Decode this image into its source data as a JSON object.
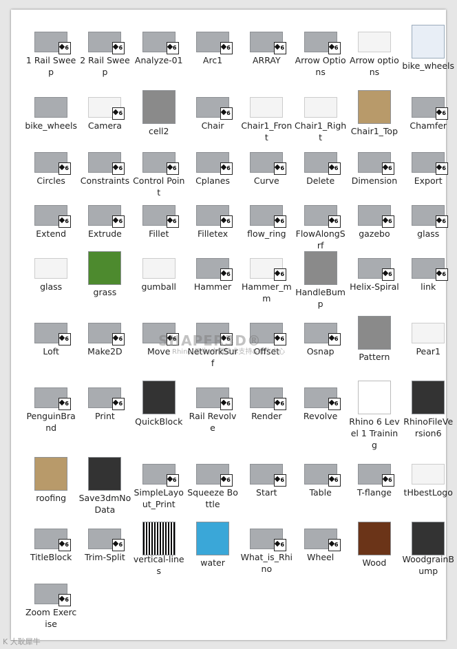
{
  "files": [
    {
      "label": "1 Rail Sweep",
      "kind": "gray",
      "badge": "6"
    },
    {
      "label": "2 Rail Sweep",
      "kind": "gray",
      "badge": "6"
    },
    {
      "label": "Analyze-01",
      "kind": "gray",
      "badge": "6"
    },
    {
      "label": "Arc1",
      "kind": "gray",
      "badge": "6"
    },
    {
      "label": "ARRAY",
      "kind": "gray",
      "badge": "6"
    },
    {
      "label": "Arrow Options",
      "kind": "gray",
      "badge": "6"
    },
    {
      "label": "Arrow options",
      "kind": "white",
      "badge": ""
    },
    {
      "label": "bike_wheels",
      "kind": "doc",
      "badge": ""
    },
    {
      "label": "bike_wheels",
      "kind": "gray",
      "badge": ""
    },
    {
      "label": "Camera",
      "kind": "white",
      "badge": "6"
    },
    {
      "label": "cell2",
      "kind": "texture",
      "badge": ""
    },
    {
      "label": "Chair",
      "kind": "gray",
      "badge": "6"
    },
    {
      "label": "Chair1_Front",
      "kind": "white",
      "badge": ""
    },
    {
      "label": "Chair1_Right",
      "kind": "white",
      "badge": ""
    },
    {
      "label": "Chair1_Top",
      "kind": "tan",
      "badge": ""
    },
    {
      "label": "Chamfer",
      "kind": "gray",
      "badge": "6"
    },
    {
      "label": "Circles",
      "kind": "gray",
      "badge": "6"
    },
    {
      "label": "Constraints",
      "kind": "gray",
      "badge": "6"
    },
    {
      "label": "Control Point",
      "kind": "gray",
      "badge": "6"
    },
    {
      "label": "Cplanes",
      "kind": "gray",
      "badge": "6"
    },
    {
      "label": "Curve",
      "kind": "gray",
      "badge": "6"
    },
    {
      "label": "Delete",
      "kind": "gray",
      "badge": "6"
    },
    {
      "label": "Dimension",
      "kind": "gray",
      "badge": "6"
    },
    {
      "label": "Export",
      "kind": "gray",
      "badge": "6"
    },
    {
      "label": "Extend",
      "kind": "gray",
      "badge": "6"
    },
    {
      "label": "Extrude",
      "kind": "gray",
      "badge": "6"
    },
    {
      "label": "Fillet",
      "kind": "gray",
      "badge": "6"
    },
    {
      "label": "Filletex",
      "kind": "gray",
      "badge": "6"
    },
    {
      "label": "flow_ring",
      "kind": "gray",
      "badge": "6"
    },
    {
      "label": "FlowAlongSrf",
      "kind": "gray",
      "badge": "6"
    },
    {
      "label": "gazebo",
      "kind": "gray",
      "badge": "6"
    },
    {
      "label": "glass",
      "kind": "gray",
      "badge": "6"
    },
    {
      "label": "glass",
      "kind": "white",
      "badge": ""
    },
    {
      "label": "grass",
      "kind": "grass",
      "badge": ""
    },
    {
      "label": "gumball",
      "kind": "white",
      "badge": ""
    },
    {
      "label": "Hammer",
      "kind": "gray",
      "badge": "6"
    },
    {
      "label": "Hammer_mm",
      "kind": "white",
      "badge": "6"
    },
    {
      "label": "HandleBump",
      "kind": "texture",
      "badge": ""
    },
    {
      "label": "Helix-Spiral",
      "kind": "gray",
      "badge": "6"
    },
    {
      "label": "link",
      "kind": "gray",
      "badge": "6"
    },
    {
      "label": "Loft",
      "kind": "gray",
      "badge": "6"
    },
    {
      "label": "Make2D",
      "kind": "gray",
      "badge": "6"
    },
    {
      "label": "Move",
      "kind": "gray",
      "badge": "6"
    },
    {
      "label": "NetworkSurf",
      "kind": "gray",
      "badge": "6"
    },
    {
      "label": "Offset",
      "kind": "gray",
      "badge": "6"
    },
    {
      "label": "Osnap",
      "kind": "gray",
      "badge": "6"
    },
    {
      "label": "Pattern",
      "kind": "texture",
      "badge": ""
    },
    {
      "label": "Pear1",
      "kind": "white",
      "badge": ""
    },
    {
      "label": "PenguinBrand",
      "kind": "gray",
      "badge": "6"
    },
    {
      "label": "Print",
      "kind": "gray",
      "badge": "6"
    },
    {
      "label": "QuickBlock",
      "kind": "dark",
      "badge": ""
    },
    {
      "label": "Rail Revolve",
      "kind": "gray",
      "badge": "6"
    },
    {
      "label": "Render",
      "kind": "gray",
      "badge": "6"
    },
    {
      "label": "Revolve",
      "kind": "gray",
      "badge": "6"
    },
    {
      "label": "Rhino 6 Level 1 Training",
      "kind": "pdf",
      "badge": ""
    },
    {
      "label": "RhinoFileVersion6",
      "kind": "dark",
      "badge": ""
    },
    {
      "label": "roofing",
      "kind": "tan",
      "badge": ""
    },
    {
      "label": "Save3dmNoData",
      "kind": "dark",
      "badge": ""
    },
    {
      "label": "SimpleLayout_Print",
      "kind": "gray",
      "badge": "6"
    },
    {
      "label": "Squeeze Bottle",
      "kind": "gray",
      "badge": "6"
    },
    {
      "label": "Start",
      "kind": "gray",
      "badge": "6"
    },
    {
      "label": "Table",
      "kind": "gray",
      "badge": "6"
    },
    {
      "label": "T-flange",
      "kind": "gray",
      "badge": "6"
    },
    {
      "label": "tHbestLogo",
      "kind": "white",
      "badge": ""
    },
    {
      "label": "TitleBlock",
      "kind": "gray",
      "badge": "6"
    },
    {
      "label": "Trim-Split",
      "kind": "gray",
      "badge": "6"
    },
    {
      "label": "vertical-lines",
      "kind": "stripe",
      "badge": ""
    },
    {
      "label": "water",
      "kind": "blue",
      "badge": ""
    },
    {
      "label": "What_is_Rhino",
      "kind": "gray",
      "badge": "6"
    },
    {
      "label": "Wheel",
      "kind": "gray",
      "badge": "6"
    },
    {
      "label": "Wood",
      "kind": "wood",
      "badge": ""
    },
    {
      "label": "WoodgrainBump",
      "kind": "dark",
      "badge": ""
    },
    {
      "label": "Zoom Exercise",
      "kind": "gray",
      "badge": "6"
    }
  ],
  "watermark": {
    "title": "SHAPER3D®",
    "subtitle": "Rhino(犀牛)中国技术支持&推广中心"
  },
  "bottom_mark": "K 大耿犀牛"
}
